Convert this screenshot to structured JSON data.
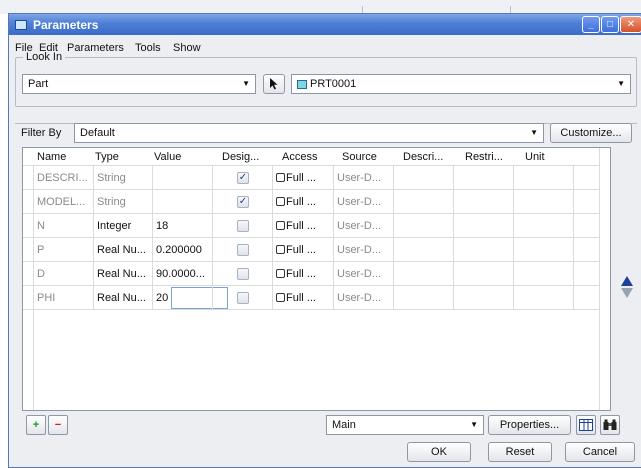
{
  "window": {
    "title": "Parameters"
  },
  "titlebar": {
    "minimize": "_",
    "maximize": "□",
    "close": "✕"
  },
  "menu": [
    "File",
    "Edit",
    "Parameters",
    "Tools",
    "Show"
  ],
  "lookin": {
    "label": "Look In",
    "type_value": "Part",
    "model_value": "PRT0001"
  },
  "filter": {
    "label": "Filter By",
    "value": "Default",
    "customize_label": "Customize..."
  },
  "table": {
    "headers": [
      "Name",
      "Type",
      "Value",
      "Desig...",
      "Access",
      "Source",
      "Descri...",
      "Restri...",
      "Unit"
    ],
    "rows": [
      {
        "name": "DESCRI...",
        "type": "String",
        "value": "",
        "designated": true,
        "access": "Full ...",
        "source": "User-D...",
        "muted": true
      },
      {
        "name": "MODEL...",
        "type": "String",
        "value": "",
        "designated": true,
        "access": "Full ...",
        "source": "User-D...",
        "muted": true
      },
      {
        "name": "N",
        "type": "Integer",
        "value": "18",
        "designated": false,
        "access": "Full ...",
        "source": "User-D...",
        "muted": false
      },
      {
        "name": "P",
        "type": "Real Nu...",
        "value": "0.200000",
        "designated": false,
        "access": "Full ...",
        "source": "User-D...",
        "muted": false
      },
      {
        "name": "D",
        "type": "Real Nu...",
        "value": "90.0000...",
        "designated": false,
        "access": "Full ...",
        "source": "User-D...",
        "muted": false
      },
      {
        "name": "PHI",
        "type": "Real Nu...",
        "value": "20",
        "designated": false,
        "access": "Full ...",
        "source": "User-D...",
        "muted": false
      }
    ],
    "check_mark": "✓"
  },
  "bottom": {
    "add": "+",
    "remove": "−",
    "view_value": "Main",
    "properties_label": "Properties...",
    "ok_label": "OK",
    "reset_label": "Reset",
    "cancel_label": "Cancel"
  },
  "colors": {
    "title_blue": "#3a6cc8",
    "accent_green": "#1a9a1a",
    "accent_red": "#cc1b1b"
  }
}
